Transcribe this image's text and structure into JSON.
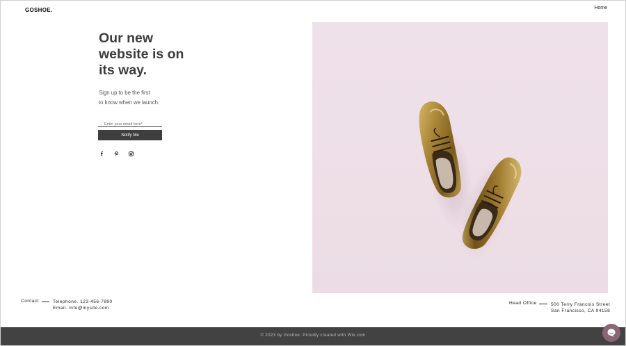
{
  "header": {
    "brand": "GOSHOE.",
    "nav_home": "Home"
  },
  "hero": {
    "headline": "Our new website is on its way.",
    "subtext_line1": "Sign up to be the first",
    "subtext_line2": "to know when we launch.",
    "email_placeholder": "Enter your email here*",
    "notify_label": "Notify Me",
    "image_description_icon": "shoes-photo"
  },
  "social": [
    {
      "icon": "facebook-icon"
    },
    {
      "icon": "pinterest-icon"
    },
    {
      "icon": "instagram-icon"
    }
  ],
  "contact": {
    "label": "Contact",
    "phone": "Telephone. 123-456-7890",
    "email": "Email. info@mysite.com"
  },
  "office": {
    "label": "Head Office",
    "street": "500 Terry Francois Street",
    "city": "San Francisco, CA 94158"
  },
  "footer": {
    "text": "© 2023 by Goshoe. Proudly created with Wix.com"
  },
  "colors": {
    "footer_bg": "#424242",
    "button_bg": "#3e3e3e",
    "hero_bg": "#efe1ea",
    "chat_bg": "#8a6676"
  }
}
